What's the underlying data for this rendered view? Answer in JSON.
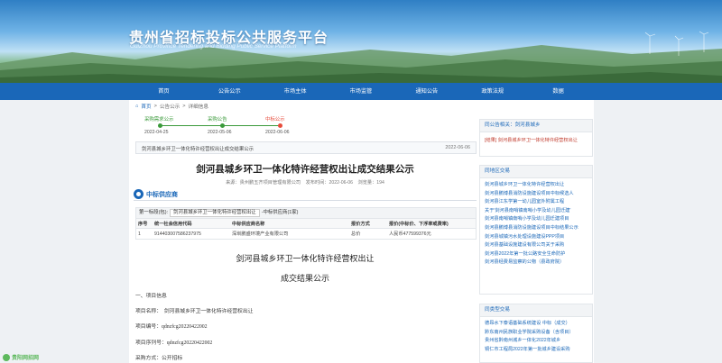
{
  "site": {
    "title": "贵州省招标投标公共服务平台",
    "subtitle": "GuiZhou Province Tendering and Bidding Public Service Platform"
  },
  "nav": [
    "首页",
    "公告公示",
    "市场主体",
    "市场监管",
    "通知公告",
    "政策法规",
    "数据"
  ],
  "breadcrumb": {
    "home": "首页",
    "sep1": ">",
    "level1": "公告公示",
    "sep2": ">",
    "current": "详细信息"
  },
  "steps": [
    {
      "label": "采购需求公示",
      "date": "2022-04-25",
      "color": "#3a9a3a"
    },
    {
      "label": "采购公告",
      "date": "2022-05-06",
      "color": "#3a9a3a"
    },
    {
      "label": "中标公示",
      "date": "2022-06-06",
      "color": "#e74c3c"
    }
  ],
  "notice": {
    "text": "剑河县城乡环卫一体化特许经营权出让成交结果公示",
    "date": "2022-06-06"
  },
  "article": {
    "title": "剑河县城乡环卫一体化特许经营权出让成交结果公示",
    "source": "来源：贵州鹏五齐项目管理有限公司",
    "time": "发布时间：2022-06-06",
    "views": "浏览量：194"
  },
  "bidder": {
    "section_title": "中标供应商",
    "package_prefix": "第一标段(包):",
    "package_name": "剑河县城乡环卫一体化特许经营权出让",
    "package_suffix": "-中标供应商(1家)",
    "columns": [
      "序号",
      "统一社会信用代码",
      "中标供应商名称",
      "报价方式",
      "报价(中标价、下浮率或费率)"
    ],
    "rows": [
      [
        "1",
        "914403007586237975",
        "深圳鹏盛环境产业有限公司",
        "总价",
        "人民币477599376元"
      ]
    ]
  },
  "doc": {
    "heading1": "剑河县城乡环卫一体化特许经营权出让",
    "heading2": "成交结果公示",
    "lines": [
      "一、项目信息",
      "项目名称：　剑河县城乡环卫一体化特许经营权出让",
      "项目编号：qdnzfcg20220422002",
      "项目序列号：qdnzfcg20220422002",
      "采购方式：公开招标"
    ]
  },
  "side1": {
    "title": "同公告相关：剑河县城乡",
    "items": [
      "[结果] 剑河县城乡环卫一体化特许经营权出让"
    ]
  },
  "side2": {
    "title": "同地区交易",
    "items": [
      "剑河县城乡环卫一体化特许经营权出让",
      "剑河县鹏博县消防设施建设项目中标候选人",
      "剑河县江东学第一幼儿园室外附属工程",
      "关于'剑河县南哨镇南哨小学及幼儿园迁建'",
      "剑河县南哨镇南哨小学及幼儿园迁建项目",
      "剑河县鹏博县消防设施建设项目中标结果公示",
      "剑河县城镇污水处理设施建设PPP项目",
      "剑河县基础设施建设有限公司关于采购",
      "剑河县2022年第一批公路安全生命防护",
      "剑河县经费易监察的公物（县政府院）"
    ]
  },
  "side3": {
    "title": "同类型交易",
    "items": [
      "德昂水下泰语基础系统建设 中标（成交）",
      "黔东南州民族职业学院采购设备（含项目）",
      "贵州省黔南州城乡一体化2022年城乡",
      "铜仁市工程局2022年第一批城乡建设采购"
    ]
  },
  "watermark": "贵阳网招网"
}
